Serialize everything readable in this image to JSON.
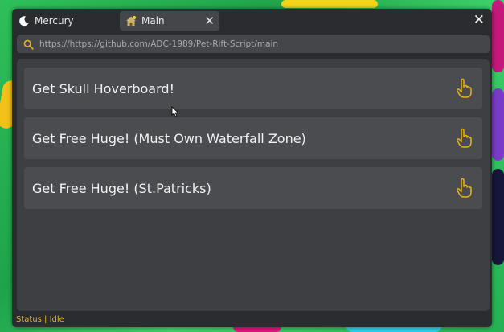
{
  "window": {
    "app_tab_label": "Mercury",
    "page_tab_label": "Main",
    "close_tab_glyph": "✕",
    "close_window_glyph": "✕"
  },
  "urlbar": {
    "value": "https://https://github.com/ADC-1989/Pet-Rift-Script/main"
  },
  "items": [
    {
      "label": "Get Skull Hoverboard!",
      "icon": "hand-pointer-icon"
    },
    {
      "label": "Get Free Huge! (Must Own Waterfall Zone)",
      "icon": "hand-pointer-icon"
    },
    {
      "label": "Get Free Huge! (St.Patricks)",
      "icon": "hand-pointer-icon"
    }
  ],
  "status": {
    "label": "Status",
    "separator": " | ",
    "value": "Idle"
  },
  "colors": {
    "accent": "#e7b21a",
    "panel": "#2b2c2f",
    "item": "#4b4c50"
  }
}
